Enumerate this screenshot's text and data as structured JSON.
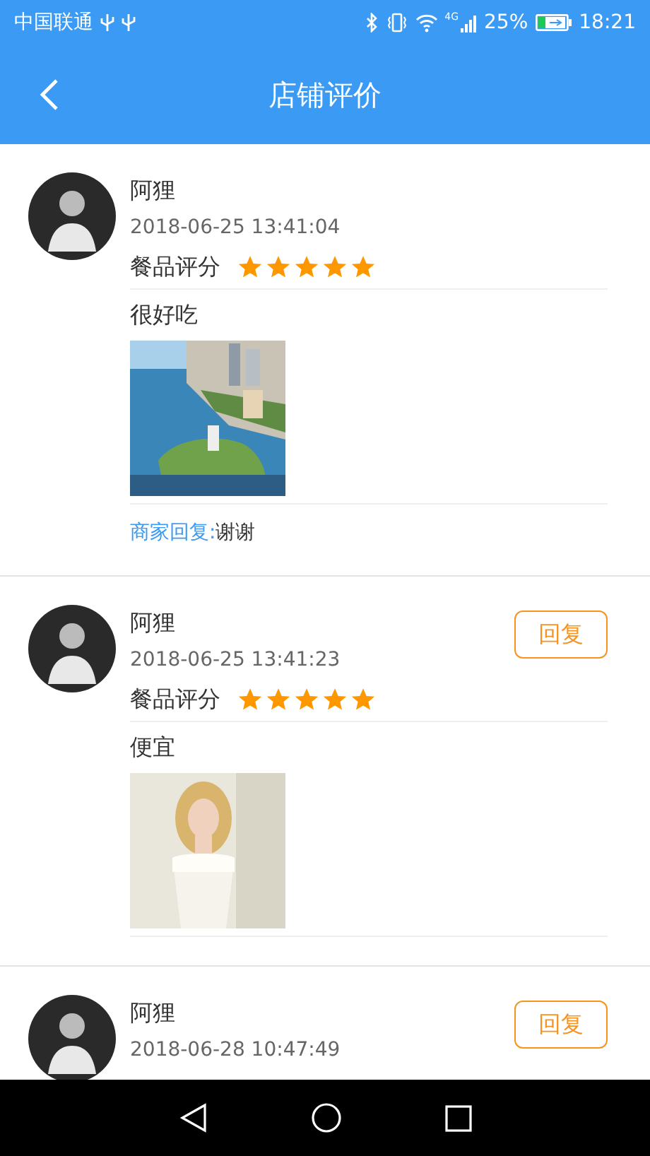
{
  "status_bar": {
    "carrier": "中国联通",
    "network": "4G",
    "battery": "25%",
    "time": "18:21"
  },
  "header": {
    "title": "店铺评价"
  },
  "reviews": [
    {
      "name": "阿狸",
      "date": "2018-06-25 13:41:04",
      "rating_label": "餐品评分",
      "stars": 5,
      "comment": "很好吃",
      "reply_label": "商家回复:",
      "reply_text": "谢谢"
    },
    {
      "name": "阿狸",
      "date": "2018-06-25 13:41:23",
      "rating_label": "餐品评分",
      "stars": 5,
      "comment": "便宜",
      "reply_button": "回复"
    },
    {
      "name": "阿狸",
      "date": "2018-06-28 10:47:49",
      "reply_button": "回复"
    }
  ]
}
